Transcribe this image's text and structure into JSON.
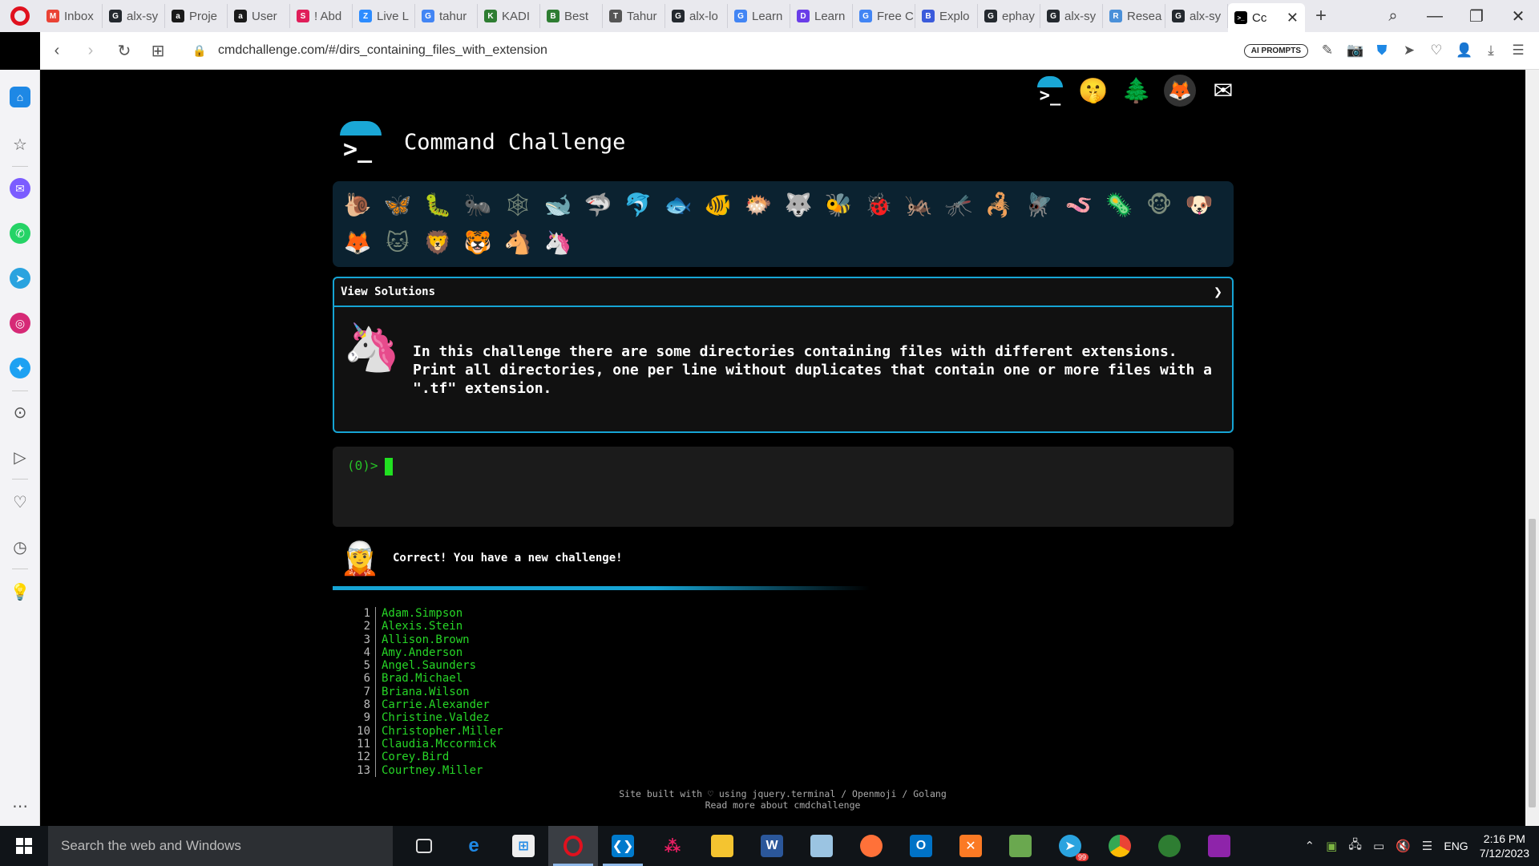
{
  "browser": {
    "tabs": [
      {
        "label": "Inbox",
        "color": "#ea4335",
        "glyph": "M"
      },
      {
        "label": "alx-sy",
        "color": "#24292f",
        "glyph": "G"
      },
      {
        "label": "Proje",
        "color": "#1a1a1a",
        "glyph": "a"
      },
      {
        "label": "User",
        "color": "#1a1a1a",
        "glyph": "a"
      },
      {
        "label": "! Abd",
        "color": "#e01e5a",
        "glyph": "S"
      },
      {
        "label": "Live L",
        "color": "#2d8cff",
        "glyph": "Z"
      },
      {
        "label": "tahur",
        "color": "#4285f4",
        "glyph": "G"
      },
      {
        "label": "KADI",
        "color": "#2e7d32",
        "glyph": "K"
      },
      {
        "label": "Best",
        "color": "#2e7d32",
        "glyph": "B"
      },
      {
        "label": "Tahur",
        "color": "#555555",
        "glyph": "T"
      },
      {
        "label": "alx-lo",
        "color": "#24292f",
        "glyph": "G"
      },
      {
        "label": "Learn",
        "color": "#4285f4",
        "glyph": "G"
      },
      {
        "label": "Learn",
        "color": "#6a3de8",
        "glyph": "D"
      },
      {
        "label": "Free C",
        "color": "#4285f4",
        "glyph": "G"
      },
      {
        "label": "Explo",
        "color": "#3b5bdb",
        "glyph": "B"
      },
      {
        "label": "ephay",
        "color": "#24292f",
        "glyph": "G"
      },
      {
        "label": "alx-sy",
        "color": "#24292f",
        "glyph": "G"
      },
      {
        "label": "Resea",
        "color": "#4a90d9",
        "glyph": "R"
      },
      {
        "label": "alx-sy",
        "color": "#24292f",
        "glyph": "G"
      }
    ],
    "active_tab": {
      "label": "Cc",
      "glyph": ">_"
    },
    "url": "cmdchallenge.com/#/dirs_containing_files_with_extension",
    "ai_prompts_label": "AI PROMPTS"
  },
  "page": {
    "title": "Command Challenge",
    "top_icons": [
      "terminal-icon",
      "shushing-face-icon",
      "tree-icon",
      "gitlab-icon",
      "mail-icon"
    ],
    "animals": [
      "🐌",
      "🦋",
      "🐛",
      "🐜",
      "🕸",
      "🐋",
      "🦈",
      "🐬",
      "🐟",
      "🐠",
      "🐡",
      "🐺",
      "🐝",
      "🐞",
      "🦗",
      "🦟",
      "🦂",
      "🪰",
      "🪱",
      "🦠",
      "🐵",
      "🐶",
      "🦊",
      "🐱",
      "🦁",
      "🐯",
      "🐴",
      "🦄"
    ],
    "solutions_label": "View Solutions",
    "description": "In this challenge there are some directories containing files with different extensions. Print all directories, one per line without duplicates that contain one or more files with a \".tf\" extension.",
    "prompt": "(0)>",
    "notice": "Correct! You have a new challenge!",
    "progress": 0.6,
    "output": [
      "Adam.Simpson",
      "Alexis.Stein",
      "Allison.Brown",
      "Amy.Anderson",
      "Angel.Saunders",
      "Brad.Michael",
      "Briana.Wilson",
      "Carrie.Alexander",
      "Christine.Valdez",
      "Christopher.Miller",
      "Claudia.Mccormick",
      "Corey.Bird",
      "Courtney.Miller"
    ],
    "footer_line1": "Site built with ♡ using jquery.terminal / Openmoji / Golang",
    "footer_line2": "Read more about cmdchallenge"
  },
  "taskbar": {
    "search_placeholder": "Search the web and Windows",
    "language": "ENG",
    "time": "2:16 PM",
    "date": "7/12/2023",
    "telegram_badge": "99"
  }
}
